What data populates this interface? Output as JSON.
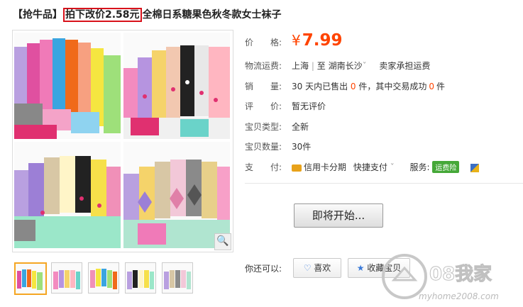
{
  "title": {
    "prefix": "【抢牛品】",
    "highlight": "拍下改价2.58元",
    "rest": "全棉日系糖果色秋冬款女士袜子"
  },
  "price": {
    "label": "价　　格:",
    "currency": "¥",
    "value": "7.99"
  },
  "shipping": {
    "label": "物流运费:",
    "from": "上海",
    "divider": "|",
    "to_word": "至",
    "to": "湖南长沙",
    "arrow": "ˇ",
    "note": "卖家承担运费"
  },
  "sales": {
    "label": "销　　量:",
    "pre": "30 天内已售出",
    "sold": "0",
    "mid": "件，其中交易成功",
    "success": "0",
    "unit": "件"
  },
  "review": {
    "label": "评　　价:",
    "value": "暂无评价"
  },
  "type": {
    "label": "宝贝类型:",
    "value": "全新"
  },
  "quantity": {
    "label": "宝贝数量:",
    "value": "30件"
  },
  "payment": {
    "label": "支　　付:",
    "card": "信用卡分期",
    "quick": "快捷支付",
    "quick_arrow": "ˇ",
    "service_label": "服务:",
    "service_badge": "运费险"
  },
  "buy_button": "即将开始...",
  "actions": {
    "label": "你还可以:",
    "like": "喜欢",
    "collect": "收藏宝贝"
  },
  "watermark": {
    "logo": "08我家",
    "url": "myhome2008.com"
  },
  "colors": {
    "accent": "#ff4400",
    "highlight_box": "#d8121b",
    "badge": "#45a838"
  },
  "icons": {
    "zoom": "magnifier-icon",
    "like": "heart-icon",
    "collect": "star-icon",
    "card": "card-icon"
  }
}
